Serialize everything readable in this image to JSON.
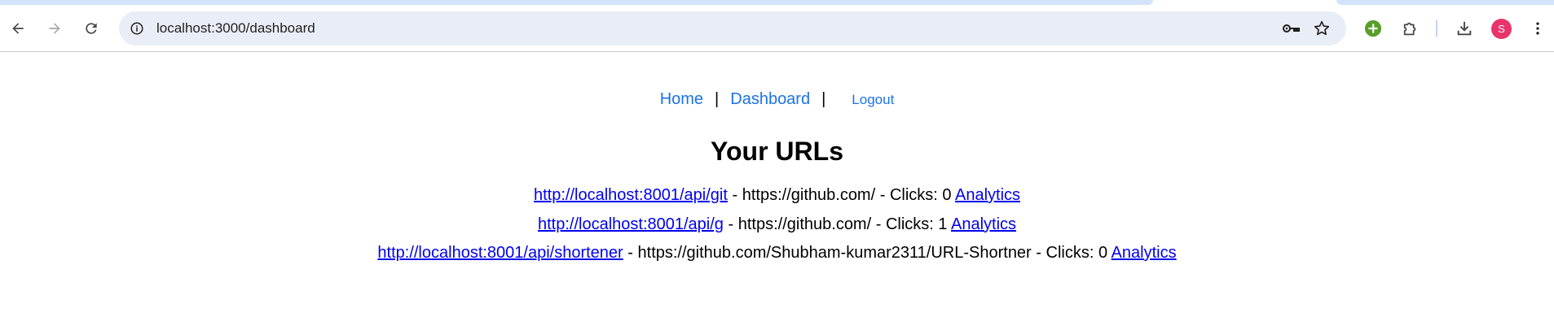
{
  "browser": {
    "url": "localhost:3000/dashboard",
    "profile_initial": "S",
    "accent_color": "#1a73e8",
    "icons": [
      "back-arrow-icon",
      "forward-arrow-icon",
      "reload-icon",
      "site-info-icon",
      "key-icon",
      "star-icon",
      "extension-add-icon",
      "puzzle-icon",
      "download-icon",
      "more-vert-icon"
    ]
  },
  "nav": {
    "home": "Home",
    "separator": "|",
    "dashboard": "Dashboard",
    "logout": "Logout"
  },
  "page": {
    "title": "Your URLs"
  },
  "urls": [
    {
      "short": "http://localhost:8001/api/git",
      "target": "https://github.com/",
      "clicks_label": "Clicks:",
      "clicks": 0,
      "analytics": "Analytics"
    },
    {
      "short": "http://localhost:8001/api/g",
      "target": "https://github.com/",
      "clicks_label": "Clicks:",
      "clicks": 1,
      "analytics": "Analytics"
    },
    {
      "short": "http://localhost:8001/api/shortener",
      "target": "https://github.com/Shubham-kumar2311/URL-Shortner",
      "clicks_label": "Clicks:",
      "clicks": 0,
      "analytics": "Analytics"
    }
  ]
}
